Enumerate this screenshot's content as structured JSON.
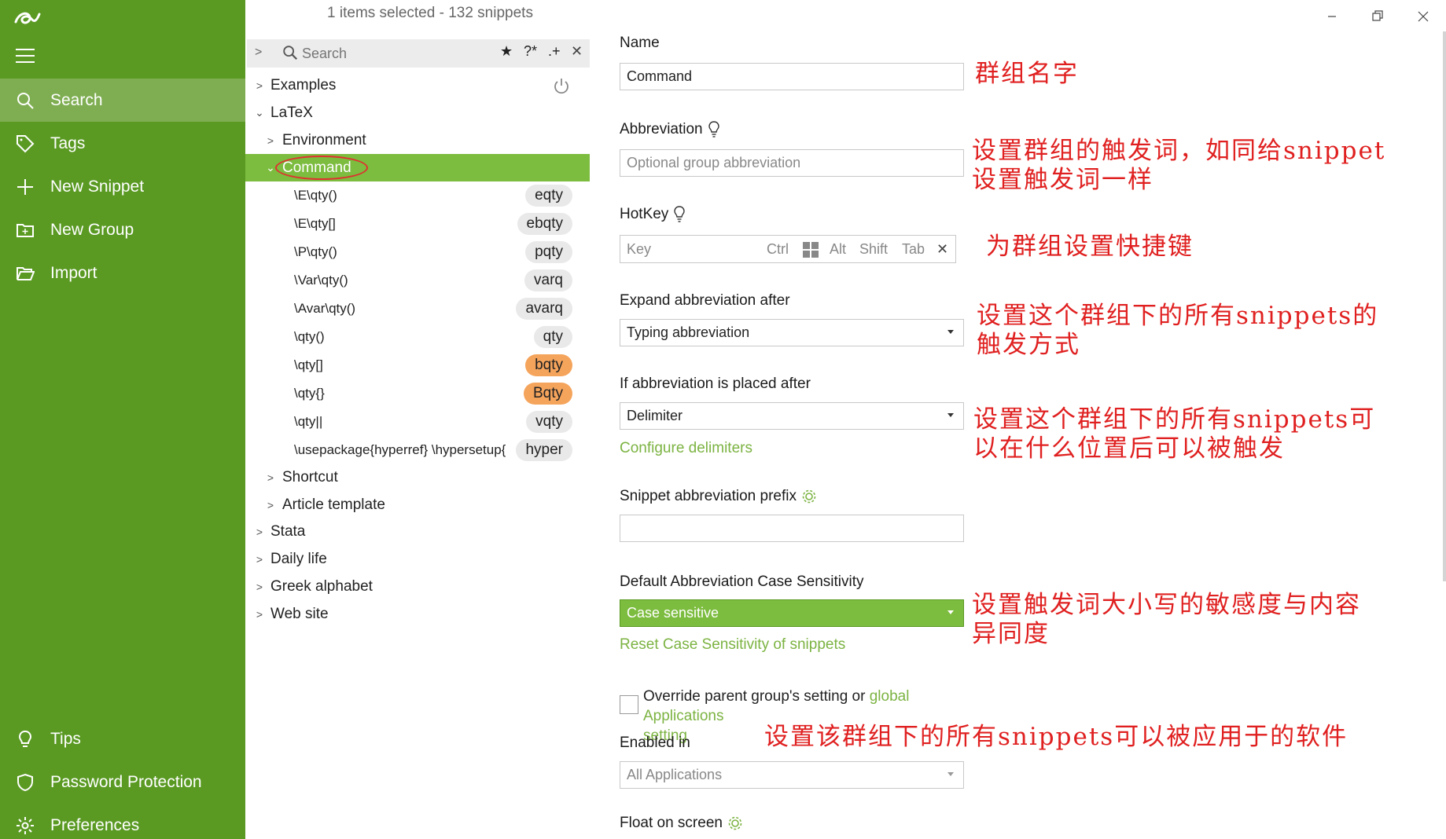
{
  "colors": {
    "sidebar": "#5a9a23",
    "sidebar_active": "#7fae52",
    "selection": "#7cbc3e",
    "link": "#7cb342",
    "badge_orange": "#f5a45c",
    "annotation": "#e02020"
  },
  "sidebar": {
    "logo_icon": "logo-icon",
    "menu_icon": "hamburger-icon",
    "items": [
      {
        "label": "Search",
        "icon": "search-icon"
      },
      {
        "label": "Tags",
        "icon": "tag-icon"
      },
      {
        "label": "New Snippet",
        "icon": "plus-icon"
      },
      {
        "label": "New Group",
        "icon": "folder-plus-icon"
      },
      {
        "label": "Import",
        "icon": "folder-open-icon"
      }
    ],
    "bottom_items": [
      {
        "label": "Tips",
        "icon": "lightbulb-icon"
      },
      {
        "label": "Password Protection",
        "icon": "shield-icon"
      },
      {
        "label": "Preferences",
        "icon": "gear-icon"
      }
    ]
  },
  "middle": {
    "status": "1 items selected - 132 snippets",
    "search": {
      "placeholder": "Search",
      "btn_star": "★",
      "btn_regex": "?*",
      "btn_wildcard": ".+",
      "btn_clear": "✕"
    },
    "tree": [
      {
        "label": "Examples",
        "expanded": false
      },
      {
        "label": "LaTeX",
        "expanded": true
      },
      {
        "label": "Environment",
        "expanded": false
      },
      {
        "label": "Command",
        "expanded": true,
        "selected": true
      }
    ],
    "snippets": [
      {
        "text": "\\E\\qty()",
        "abbr": "eqty",
        "highlight": false
      },
      {
        "text": "\\E\\qty[]",
        "abbr": "ebqty",
        "highlight": false
      },
      {
        "text": "\\P\\qty()",
        "abbr": "pqty",
        "highlight": false
      },
      {
        "text": "\\Var\\qty()",
        "abbr": "varq",
        "highlight": false
      },
      {
        "text": "\\Avar\\qty()",
        "abbr": "avarq",
        "highlight": false
      },
      {
        "text": "\\qty()",
        "abbr": "qty",
        "highlight": false
      },
      {
        "text": "\\qty[]",
        "abbr": "bqty",
        "highlight": true
      },
      {
        "text": "\\qty{}",
        "abbr": "Bqty",
        "highlight": true
      },
      {
        "text": "\\qty||",
        "abbr": "vqty",
        "highlight": false
      },
      {
        "text": "\\usepackage{hyperref} \\hypersetup{",
        "abbr": "hyper",
        "highlight": false
      }
    ],
    "tree_after": [
      {
        "label": "Shortcut"
      },
      {
        "label": "Article template"
      },
      {
        "label": "Stata"
      },
      {
        "label": "Daily life"
      },
      {
        "label": "Greek alphabet"
      },
      {
        "label": "Web site"
      }
    ]
  },
  "right": {
    "name_label": "Name",
    "name_value": "Command",
    "abbr_label": "Abbreviation",
    "abbr_placeholder": "Optional group abbreviation",
    "hotkey_label": "HotKey",
    "hotkey": {
      "key": "Key",
      "ctrl": "Ctrl",
      "alt": "Alt",
      "shift": "Shift",
      "tab": "Tab",
      "clear": "✕"
    },
    "expand_label": "Expand abbreviation after",
    "expand_value": "Typing abbreviation",
    "placed_label": "If abbreviation is placed after",
    "placed_value": "Delimiter",
    "configure_link": "Configure delimiters",
    "prefix_label": "Snippet abbreviation prefix",
    "case_label": "Default Abbreviation Case Sensitivity",
    "case_value": "Case sensitive",
    "reset_link": "Reset Case Sensitivity of snippets",
    "override_text_a": "Override parent group's setting or ",
    "override_link_a": "global Applications",
    "override_link_b": "setting",
    "enabled_label": "Enabled in",
    "enabled_value": "All Applications",
    "float_label": "Float on screen",
    "annotations": {
      "name": "群组名字",
      "abbr_1": "设置群组的触发词，如同给snippet",
      "abbr_2": "设置触发词一样",
      "hotkey": "为群组设置快捷键",
      "expand_1": "设置这个群组下的所有snippets的",
      "expand_2": "触发方式",
      "placed_1": "设置这个群组下的所有snippets可",
      "placed_2": "以在什么位置后可以被触发",
      "case_1": "设置触发词大小写的敏感度与内容",
      "case_2": "异同度",
      "enabled": "设置该群组下的所有snippets可以被应用于的软件"
    }
  }
}
